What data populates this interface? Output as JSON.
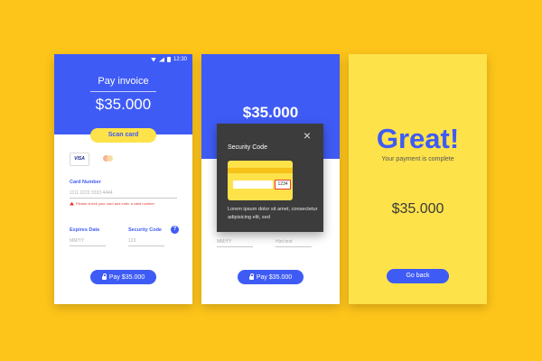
{
  "colors": {
    "background": "#FDC41A",
    "primary": "#3F5BF5",
    "accent_yellow": "#FDE24A",
    "error": "#E53935",
    "modal": "#3C3C3C"
  },
  "screen1": {
    "status_time": "12:30",
    "title": "Pay invoice",
    "amount": "$35.000",
    "scan_button": "Scan card",
    "visa_label": "VISA",
    "card_number_label": "Card Number",
    "card_number_value": "1111 2222 3333 4444",
    "error_text": "Please check your card and enter a valid number",
    "expires_label": "Expires Date",
    "expires_placeholder": "MM/YY",
    "security_label": "Security Code",
    "security_placeholder": "123",
    "help_icon": "?",
    "pay_button": "Pay $35.000"
  },
  "screen2": {
    "amount": "$35.000",
    "modal_title": "Security Code",
    "modal_close": "×",
    "cvv": "1234",
    "modal_text": "Lorem ipsum dolor sit amet, consectetur adipisicing elit, sed",
    "expires_placeholder": "MM/YY",
    "hint_placeholder": "Hint text",
    "pay_button": "Pay $35.000"
  },
  "screen3": {
    "headline": "Great!",
    "subtitle": "Your payment is complete",
    "amount": "$35.000",
    "back_button": "Go back"
  }
}
